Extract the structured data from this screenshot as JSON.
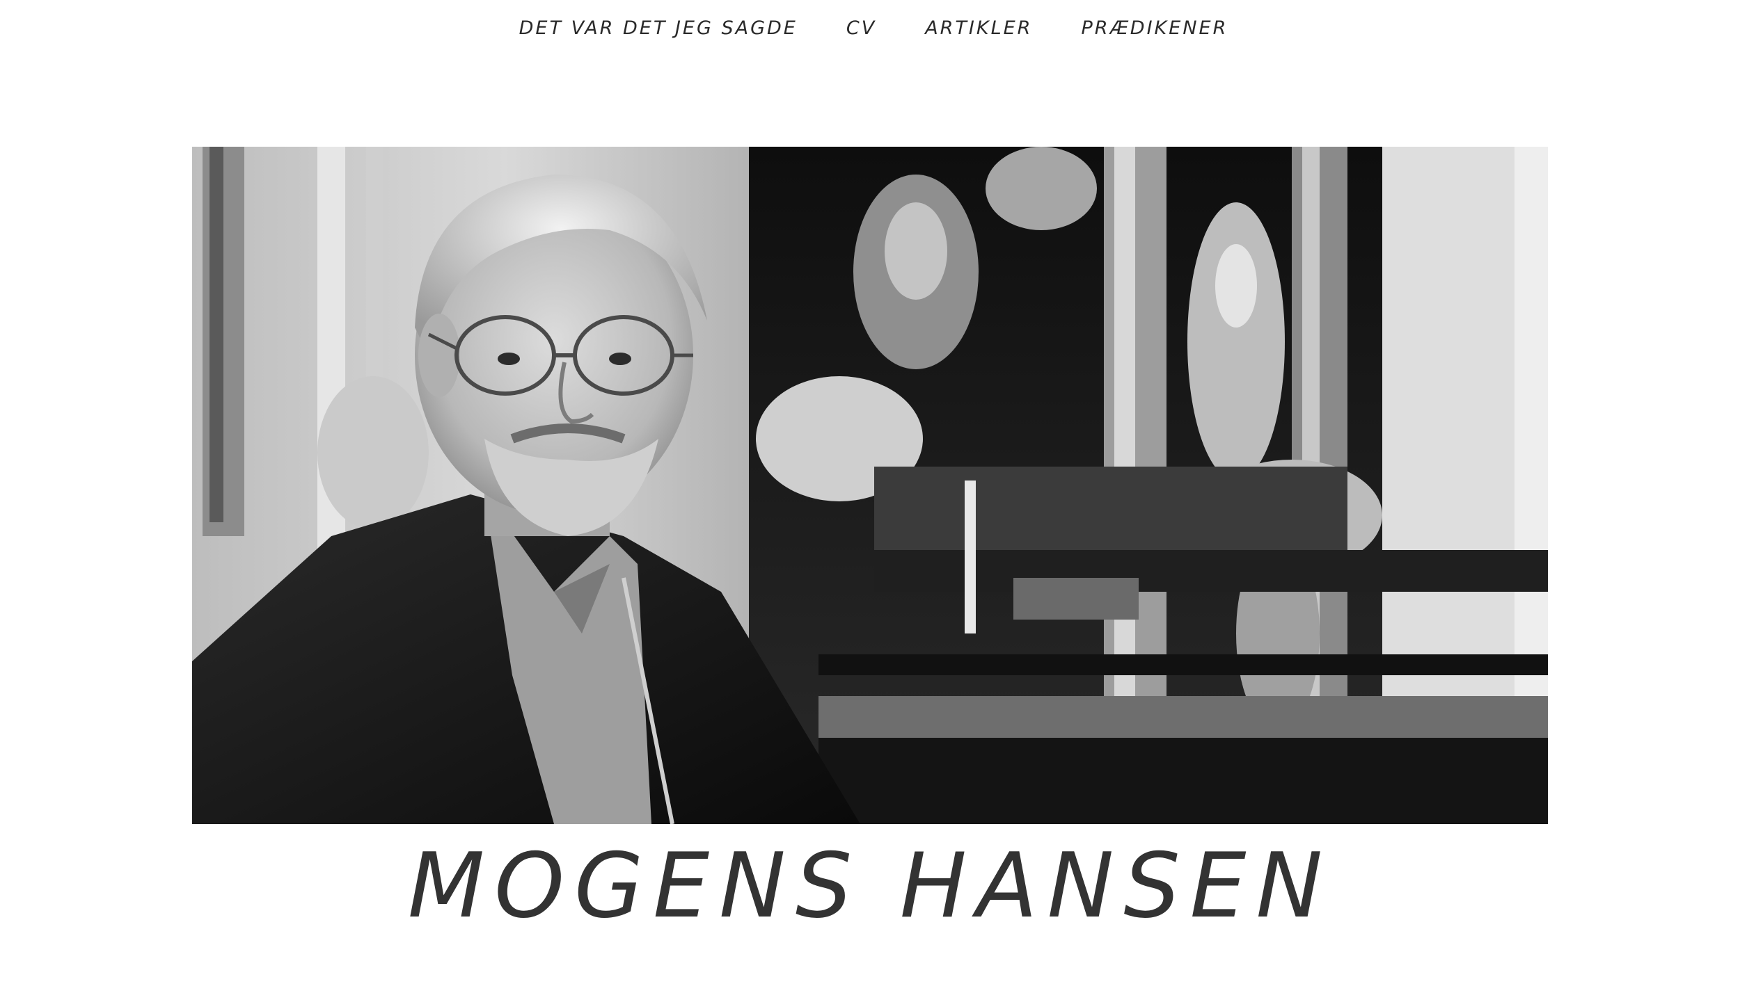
{
  "nav": {
    "items": [
      {
        "label": "DET VAR DET JEG SAGDE"
      },
      {
        "label": "CV"
      },
      {
        "label": "ARTIKLER"
      },
      {
        "label": "PRÆDIKENER"
      }
    ]
  },
  "hero": {
    "style": "black-and-white",
    "subject": "portrait-photo"
  },
  "site": {
    "title": "MOGENS HANSEN"
  },
  "colors": {
    "text": "#2b2b2b",
    "title": "#333333",
    "background": "#ffffff"
  }
}
